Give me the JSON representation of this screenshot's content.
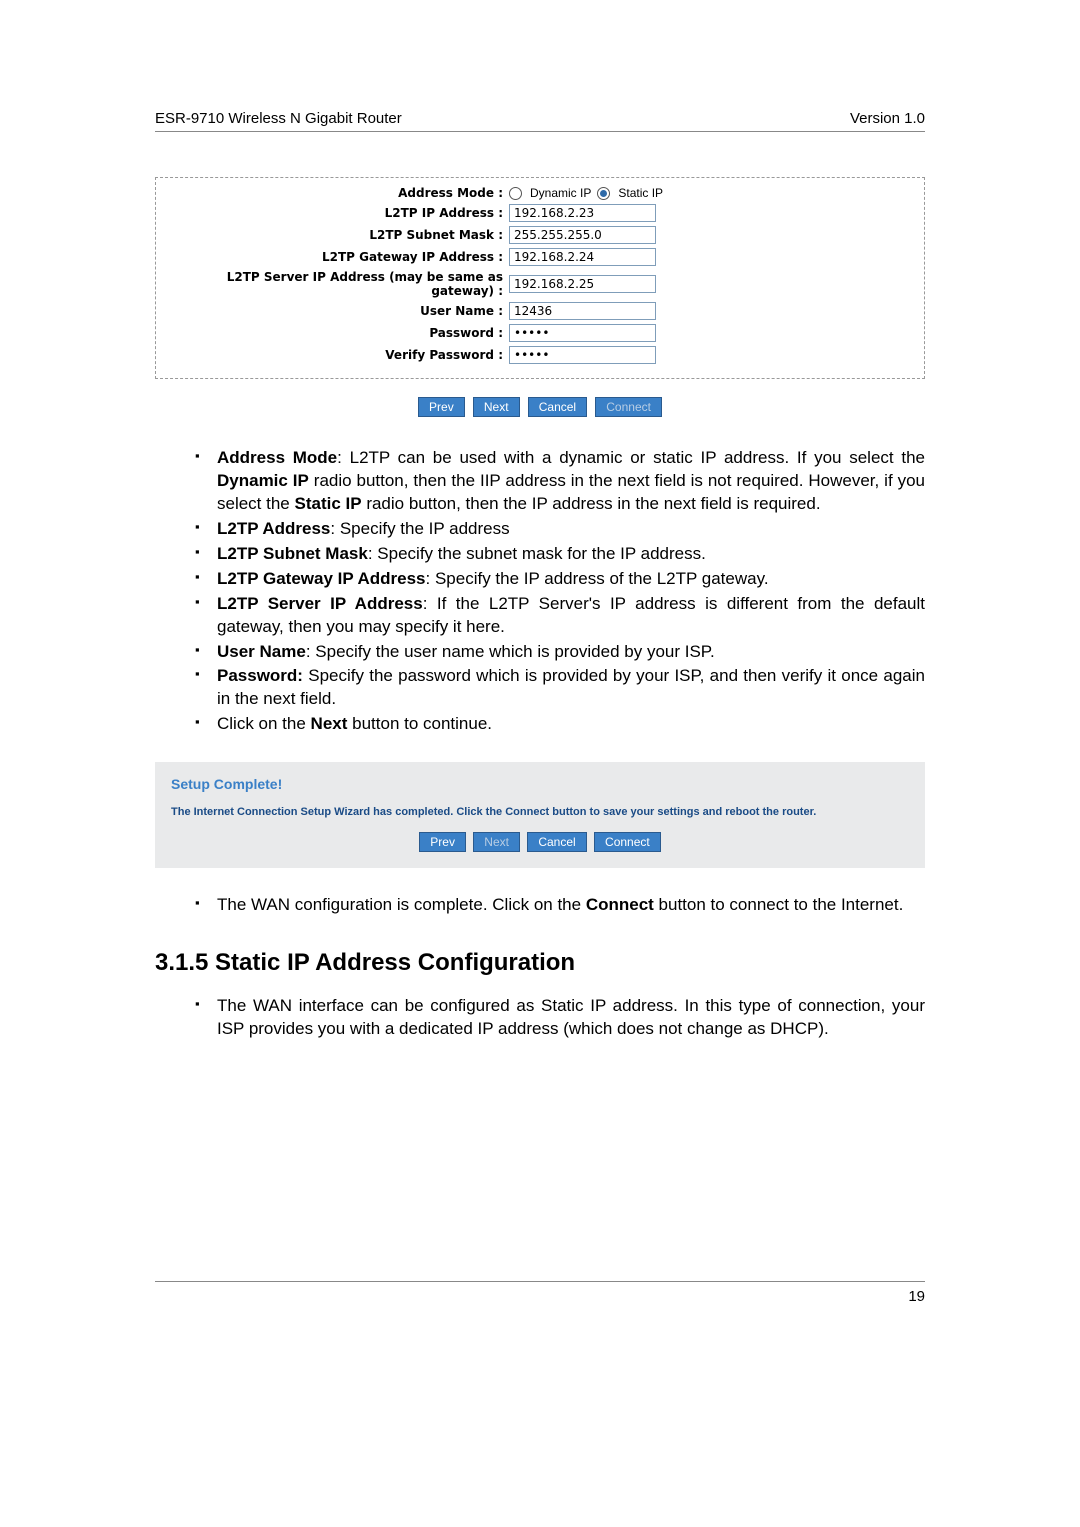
{
  "header": {
    "left": "ESR-9710 Wireless N Gigabit Router",
    "right": "Version 1.0"
  },
  "form": {
    "labels": {
      "address_mode": "Address Mode :",
      "ip": "L2TP IP Address :",
      "mask": "L2TP Subnet Mask :",
      "gateway": "L2TP Gateway IP Address :",
      "server": "L2TP Server IP Address (may be same as gateway) :",
      "user": "User Name :",
      "pass": "Password :",
      "verify": "Verify Password :"
    },
    "radio": {
      "dynamic": "Dynamic IP",
      "static": "Static IP",
      "selected": "static"
    },
    "values": {
      "ip": "192.168.2.23",
      "mask": "255.255.255.0",
      "gateway": "192.168.2.24",
      "server": "192.168.2.25",
      "user": "12436",
      "pass": "•••••",
      "verify": "•••••"
    }
  },
  "buttons1": {
    "prev": "Prev",
    "next": "Next",
    "cancel": "Cancel",
    "connect": "Connect"
  },
  "bullets1": [
    {
      "bold": "Address Mode",
      "text": ": L2TP can be used with a dynamic or static IP address. If you select the ",
      "bold2": "Dynamic IP",
      "text2": " radio button, then the IIP address in the next field is not required. However, if you select the ",
      "bold3": "Static IP",
      "text3": " radio button, then the IP address in the next field is required."
    },
    {
      "bold": "L2TP Address",
      "text": ": Specify the IP address"
    },
    {
      "bold": "L2TP Subnet Mask",
      "text": ": Specify the subnet mask for the IP address."
    },
    {
      "bold": "L2TP Gateway IP Address",
      "text": ": Specify the IP address of the L2TP gateway."
    },
    {
      "bold": "L2TP Server IP Address",
      "text": ": If the L2TP Server's IP address is different from the default gateway, then you may specify it here."
    },
    {
      "bold": "User Name",
      "text": ": Specify the user name which is provided by your ISP."
    },
    {
      "bold": "Password:",
      "text": " Specify the password which is provided by your ISP, and then verify it once again in the next field."
    },
    {
      "plain1": "Click on the ",
      "bold": "Next",
      "text": " button to continue."
    }
  ],
  "complete": {
    "title": "Setup Complete!",
    "msg": "The Internet Connection Setup Wizard has completed. Click the Connect button to save your settings and reboot the router."
  },
  "buttons2": {
    "prev": "Prev",
    "next": "Next",
    "cancel": "Cancel",
    "connect": "Connect"
  },
  "bullets2": [
    {
      "plain1": "The WAN configuration is complete. Click on the ",
      "bold": "Connect",
      "text": " button to connect to the Internet."
    }
  ],
  "section_heading": "3.1.5 Static IP Address Configuration",
  "bullets3": [
    {
      "plain1": "The WAN interface can be configured as Static IP address. In this type of connection, your ISP provides you with a dedicated IP address (which does not change as DHCP)."
    }
  ],
  "page_number": "19"
}
